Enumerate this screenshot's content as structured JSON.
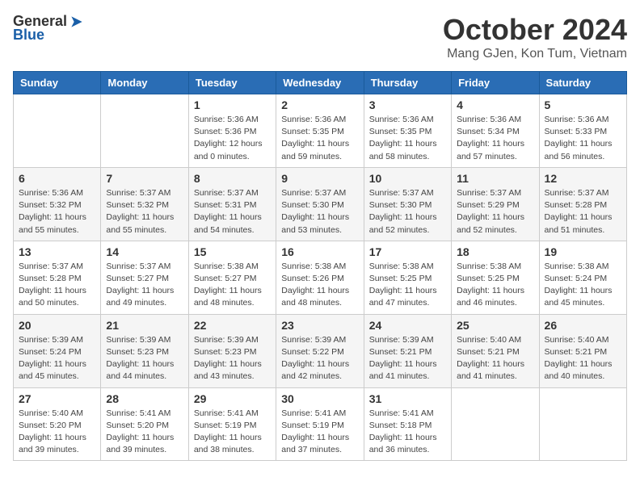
{
  "logo": {
    "general": "General",
    "blue": "Blue"
  },
  "title": "October 2024",
  "location": "Mang GJen, Kon Tum, Vietnam",
  "days_of_week": [
    "Sunday",
    "Monday",
    "Tuesday",
    "Wednesday",
    "Thursday",
    "Friday",
    "Saturday"
  ],
  "weeks": [
    [
      {
        "day": "",
        "sunrise": "",
        "sunset": "",
        "daylight": ""
      },
      {
        "day": "",
        "sunrise": "",
        "sunset": "",
        "daylight": ""
      },
      {
        "day": "1",
        "sunrise": "Sunrise: 5:36 AM",
        "sunset": "Sunset: 5:36 PM",
        "daylight": "Daylight: 12 hours and 0 minutes."
      },
      {
        "day": "2",
        "sunrise": "Sunrise: 5:36 AM",
        "sunset": "Sunset: 5:35 PM",
        "daylight": "Daylight: 11 hours and 59 minutes."
      },
      {
        "day": "3",
        "sunrise": "Sunrise: 5:36 AM",
        "sunset": "Sunset: 5:35 PM",
        "daylight": "Daylight: 11 hours and 58 minutes."
      },
      {
        "day": "4",
        "sunrise": "Sunrise: 5:36 AM",
        "sunset": "Sunset: 5:34 PM",
        "daylight": "Daylight: 11 hours and 57 minutes."
      },
      {
        "day": "5",
        "sunrise": "Sunrise: 5:36 AM",
        "sunset": "Sunset: 5:33 PM",
        "daylight": "Daylight: 11 hours and 56 minutes."
      }
    ],
    [
      {
        "day": "6",
        "sunrise": "Sunrise: 5:36 AM",
        "sunset": "Sunset: 5:32 PM",
        "daylight": "Daylight: 11 hours and 55 minutes."
      },
      {
        "day": "7",
        "sunrise": "Sunrise: 5:37 AM",
        "sunset": "Sunset: 5:32 PM",
        "daylight": "Daylight: 11 hours and 55 minutes."
      },
      {
        "day": "8",
        "sunrise": "Sunrise: 5:37 AM",
        "sunset": "Sunset: 5:31 PM",
        "daylight": "Daylight: 11 hours and 54 minutes."
      },
      {
        "day": "9",
        "sunrise": "Sunrise: 5:37 AM",
        "sunset": "Sunset: 5:30 PM",
        "daylight": "Daylight: 11 hours and 53 minutes."
      },
      {
        "day": "10",
        "sunrise": "Sunrise: 5:37 AM",
        "sunset": "Sunset: 5:30 PM",
        "daylight": "Daylight: 11 hours and 52 minutes."
      },
      {
        "day": "11",
        "sunrise": "Sunrise: 5:37 AM",
        "sunset": "Sunset: 5:29 PM",
        "daylight": "Daylight: 11 hours and 52 minutes."
      },
      {
        "day": "12",
        "sunrise": "Sunrise: 5:37 AM",
        "sunset": "Sunset: 5:28 PM",
        "daylight": "Daylight: 11 hours and 51 minutes."
      }
    ],
    [
      {
        "day": "13",
        "sunrise": "Sunrise: 5:37 AM",
        "sunset": "Sunset: 5:28 PM",
        "daylight": "Daylight: 11 hours and 50 minutes."
      },
      {
        "day": "14",
        "sunrise": "Sunrise: 5:37 AM",
        "sunset": "Sunset: 5:27 PM",
        "daylight": "Daylight: 11 hours and 49 minutes."
      },
      {
        "day": "15",
        "sunrise": "Sunrise: 5:38 AM",
        "sunset": "Sunset: 5:27 PM",
        "daylight": "Daylight: 11 hours and 48 minutes."
      },
      {
        "day": "16",
        "sunrise": "Sunrise: 5:38 AM",
        "sunset": "Sunset: 5:26 PM",
        "daylight": "Daylight: 11 hours and 48 minutes."
      },
      {
        "day": "17",
        "sunrise": "Sunrise: 5:38 AM",
        "sunset": "Sunset: 5:25 PM",
        "daylight": "Daylight: 11 hours and 47 minutes."
      },
      {
        "day": "18",
        "sunrise": "Sunrise: 5:38 AM",
        "sunset": "Sunset: 5:25 PM",
        "daylight": "Daylight: 11 hours and 46 minutes."
      },
      {
        "day": "19",
        "sunrise": "Sunrise: 5:38 AM",
        "sunset": "Sunset: 5:24 PM",
        "daylight": "Daylight: 11 hours and 45 minutes."
      }
    ],
    [
      {
        "day": "20",
        "sunrise": "Sunrise: 5:39 AM",
        "sunset": "Sunset: 5:24 PM",
        "daylight": "Daylight: 11 hours and 45 minutes."
      },
      {
        "day": "21",
        "sunrise": "Sunrise: 5:39 AM",
        "sunset": "Sunset: 5:23 PM",
        "daylight": "Daylight: 11 hours and 44 minutes."
      },
      {
        "day": "22",
        "sunrise": "Sunrise: 5:39 AM",
        "sunset": "Sunset: 5:23 PM",
        "daylight": "Daylight: 11 hours and 43 minutes."
      },
      {
        "day": "23",
        "sunrise": "Sunrise: 5:39 AM",
        "sunset": "Sunset: 5:22 PM",
        "daylight": "Daylight: 11 hours and 42 minutes."
      },
      {
        "day": "24",
        "sunrise": "Sunrise: 5:39 AM",
        "sunset": "Sunset: 5:21 PM",
        "daylight": "Daylight: 11 hours and 41 minutes."
      },
      {
        "day": "25",
        "sunrise": "Sunrise: 5:40 AM",
        "sunset": "Sunset: 5:21 PM",
        "daylight": "Daylight: 11 hours and 41 minutes."
      },
      {
        "day": "26",
        "sunrise": "Sunrise: 5:40 AM",
        "sunset": "Sunset: 5:21 PM",
        "daylight": "Daylight: 11 hours and 40 minutes."
      }
    ],
    [
      {
        "day": "27",
        "sunrise": "Sunrise: 5:40 AM",
        "sunset": "Sunset: 5:20 PM",
        "daylight": "Daylight: 11 hours and 39 minutes."
      },
      {
        "day": "28",
        "sunrise": "Sunrise: 5:41 AM",
        "sunset": "Sunset: 5:20 PM",
        "daylight": "Daylight: 11 hours and 39 minutes."
      },
      {
        "day": "29",
        "sunrise": "Sunrise: 5:41 AM",
        "sunset": "Sunset: 5:19 PM",
        "daylight": "Daylight: 11 hours and 38 minutes."
      },
      {
        "day": "30",
        "sunrise": "Sunrise: 5:41 AM",
        "sunset": "Sunset: 5:19 PM",
        "daylight": "Daylight: 11 hours and 37 minutes."
      },
      {
        "day": "31",
        "sunrise": "Sunrise: 5:41 AM",
        "sunset": "Sunset: 5:18 PM",
        "daylight": "Daylight: 11 hours and 36 minutes."
      },
      {
        "day": "",
        "sunrise": "",
        "sunset": "",
        "daylight": ""
      },
      {
        "day": "",
        "sunrise": "",
        "sunset": "",
        "daylight": ""
      }
    ]
  ]
}
